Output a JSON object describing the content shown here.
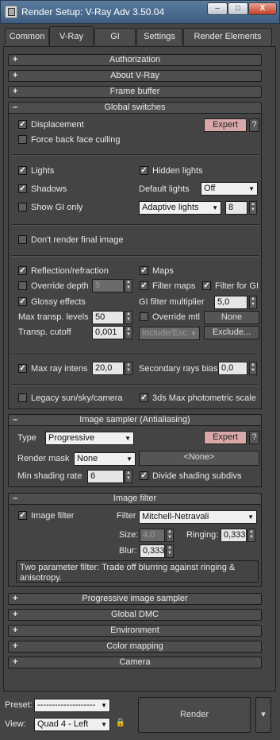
{
  "window": {
    "title": "Render Setup: V-Ray Adv 3.50.04",
    "min": "–",
    "max": "□",
    "close": "X"
  },
  "tabs": [
    "Common",
    "V-Ray",
    "GI",
    "Settings",
    "Render Elements"
  ],
  "sign": {
    "plus": "+",
    "minus": "–"
  },
  "rollouts": {
    "authorization": "Authorization",
    "about": "About V-Ray",
    "frame_buffer": "Frame buffer",
    "global_switches": "Global switches",
    "image_sampler": "Image sampler (Antialiasing)",
    "image_filter": "Image filter",
    "progressive": "Progressive image sampler",
    "global_dmc": "Global DMC",
    "environment": "Environment",
    "color_mapping": "Color mapping",
    "camera": "Camera"
  },
  "global_switches": {
    "displacement": "Displacement",
    "expert": "Expert",
    "help": "?",
    "force_back_face": "Force back face culling",
    "lights": "Lights",
    "hidden_lights": "Hidden lights",
    "shadows": "Shadows",
    "default_lights_label": "Default lights",
    "default_lights_value": "Off",
    "show_gi_only": "Show GI only",
    "adaptive_lights": "Adaptive lights",
    "adaptive_value": "8",
    "dont_render": "Don't render final image",
    "reflection": "Reflection/refraction",
    "maps": "Maps",
    "override_depth": "Override depth",
    "override_depth_value": "5",
    "filter_maps": "Filter maps",
    "filter_for_gi": "Filter for GI",
    "glossy": "Glossy effects",
    "gi_filter_mult_label": "GI filter multiplier",
    "gi_filter_mult_value": "5,0",
    "max_transp_label": "Max transp. levels",
    "max_transp_value": "50",
    "override_mtl": "Override mtl",
    "none_button": "None",
    "transp_cutoff_label": "Transp. cutoff",
    "transp_cutoff_value": "0,001",
    "include_exclude": "Include/Exc",
    "exclude_button": "Exclude...",
    "max_ray_intens": "Max ray intens",
    "max_ray_value": "20,0",
    "secondary_bias_label": "Secondary rays bias",
    "secondary_bias_value": "0,0",
    "legacy_sun": "Legacy sun/sky/camera",
    "photometric": "3ds Max photometric scale"
  },
  "image_sampler": {
    "type_label": "Type",
    "type_value": "Progressive",
    "expert": "Expert",
    "help": "?",
    "render_mask_label": "Render mask",
    "render_mask_value": "None",
    "mask_button": "<None>",
    "min_shading_label": "Min shading rate",
    "min_shading_value": "6",
    "divide_subdivs": "Divide shading subdivs"
  },
  "image_filter": {
    "enabled": "Image filter",
    "filter_label": "Filter",
    "filter_value": "Mitchell-Netravali",
    "size_label": "Size:",
    "size_value": "4,0",
    "ringing_label": "Ringing:",
    "ringing_value": "0,333",
    "blur_label": "Blur:",
    "blur_value": "0,333",
    "description": "Two parameter filter: Trade off blurring against ringing & anisotropy."
  },
  "bottom": {
    "preset_label": "Preset:",
    "preset_value": "--------------------",
    "view_label": "View:",
    "view_value": "Quad 4 - Left",
    "render_button": "Render",
    "render_menu": "▾"
  },
  "icons": {
    "check": "✓",
    "arrow": "▼",
    "spin_up": "▲",
    "spin_down": "▼",
    "lock": "🔒"
  }
}
